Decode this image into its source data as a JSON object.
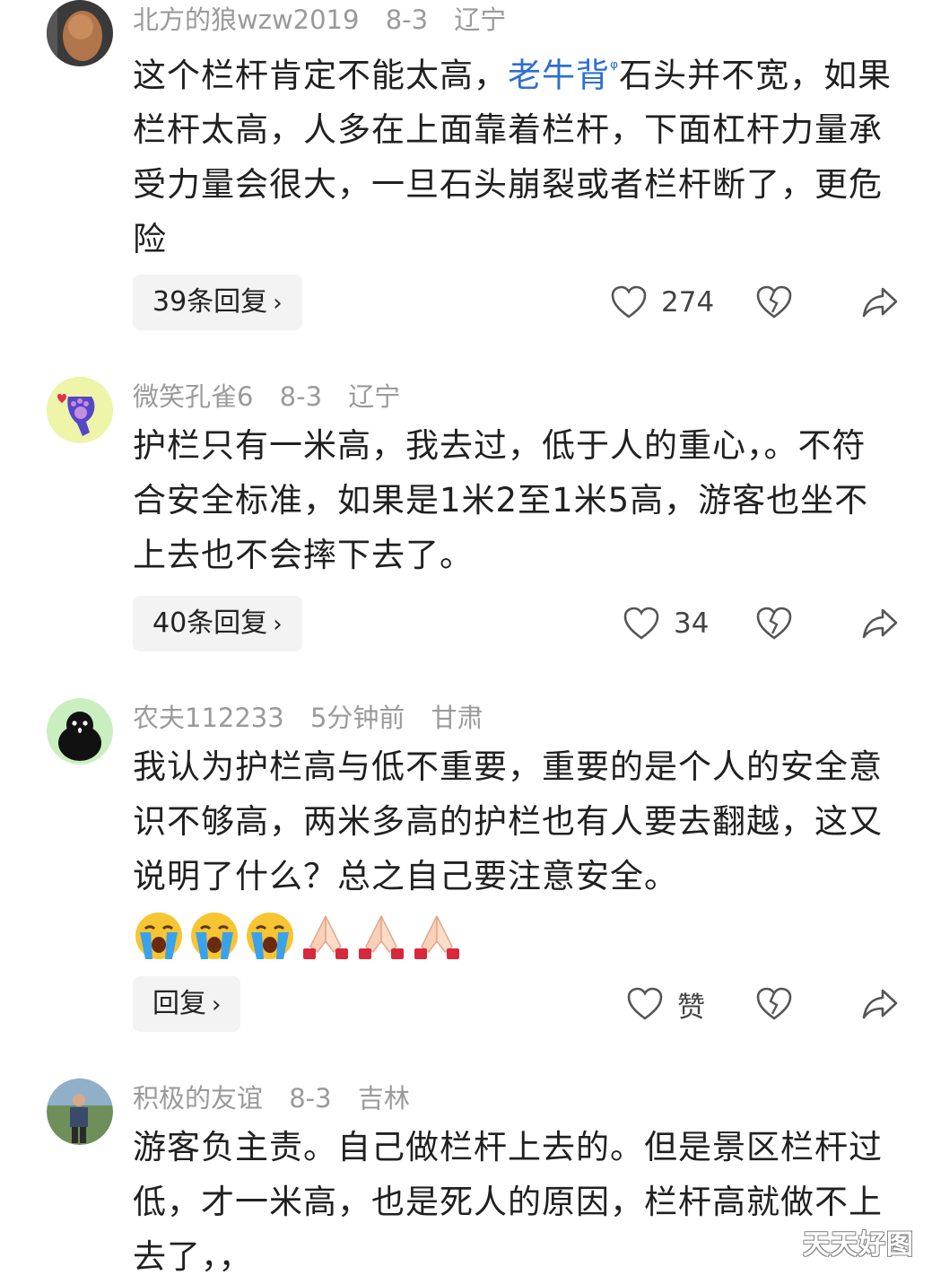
{
  "comments": [
    {
      "username": "北方的狼wzw2019",
      "date": "8-3",
      "location": "辽宁",
      "text_before_link": "这个栏杆肯定不能太高，",
      "link_text": "老牛背",
      "search_mark": "ᵠ",
      "text_after_link": "石头并不宽，如果栏杆太高，人多在上面靠着栏杆，下面杠杆力量承受力量会很大，一旦石头崩裂或者栏杆断了，更危险",
      "reply_label": "39条回复",
      "likes": "274"
    },
    {
      "username": "微笑孔雀6",
      "date": "8-3",
      "location": "辽宁",
      "text": "护栏只有一米高，我去过，低于人的重心，。不符合安全标准，如果是1米2至1米5高，游客也坐不上去也不会摔下去了。",
      "reply_label": "40条回复",
      "likes": "34"
    },
    {
      "username": "农夫112233",
      "date": "5分钟前",
      "location": "甘肃",
      "text": "我认为护栏高与低不重要，重要的是个人的安全意识不够高，两米多高的护栏也有人要去翻越，这又说明了什么？总之自己要注意安全。",
      "emojis": [
        "crying-emoji",
        "crying-emoji",
        "crying-emoji",
        "praying-hands-emoji",
        "praying-hands-emoji",
        "praying-hands-emoji"
      ],
      "reply_label": "回复",
      "likes": "赞"
    },
    {
      "username": "积极的友谊",
      "date": "8-3",
      "location": "吉林",
      "text": "游客负主责。自己做栏杆上去的。但是景区栏杆过低，才一米高，也是死人的原因，栏杆高就做不上去了，，"
    }
  ],
  "chevron": "›",
  "watermark": "天天好图",
  "colors": {
    "link": "#2d6fd2",
    "meta": "#9a9a9a",
    "pill_bg": "#f3f3f3"
  }
}
